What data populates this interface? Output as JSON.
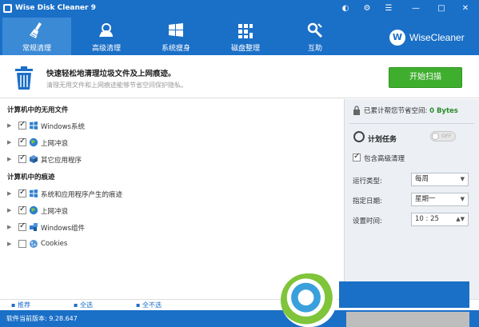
{
  "window": {
    "title": "Wise Disk Cleaner 9"
  },
  "tabs": [
    {
      "label": "常规清理",
      "icon": "broom-icon",
      "active": true
    },
    {
      "label": "高级清理",
      "icon": "advanced-clean-icon",
      "active": false
    },
    {
      "label": "系统瘦身",
      "icon": "windows-icon",
      "active": false
    },
    {
      "label": "磁盘整理",
      "icon": "defrag-icon",
      "active": false
    },
    {
      "label": "互助",
      "icon": "tools-icon",
      "active": false
    }
  ],
  "brand": {
    "logo_letter": "W",
    "name": "WiseCleaner"
  },
  "banner": {
    "title": "快速轻松地清理垃圾文件及上网痕迹。",
    "subtitle": "清理无用文件和上网痕迹能够节省空间保护隐私。",
    "scan_button": "开始扫描"
  },
  "left": {
    "section1_title": "计算机中的无用文件",
    "section1_items": [
      {
        "label": "Windows系统",
        "checked": true,
        "icon": "windows-icon"
      },
      {
        "label": "上网冲浪",
        "checked": true,
        "icon": "globe-icon"
      },
      {
        "label": "其它应用程序",
        "checked": true,
        "icon": "app-box-icon"
      }
    ],
    "section2_title": "计算机中的痕迹",
    "section2_items": [
      {
        "label": "系统和应用程序产生的痕迹",
        "checked": true,
        "icon": "windows-icon"
      },
      {
        "label": "上网冲浪",
        "checked": true,
        "icon": "globe-icon"
      },
      {
        "label": "Windows组件",
        "checked": true,
        "icon": "puzzle-icon"
      },
      {
        "label": "Cookies",
        "checked": false,
        "icon": "cookie-icon"
      }
    ]
  },
  "right": {
    "saved_label": "已累计帮您节省空间: ",
    "saved_value": "0 Bytes",
    "schedule_title": "计划任务",
    "toggle_text": "OFF",
    "include_advanced": "包含高级清理",
    "run_type_label": "运行类型:",
    "run_type_value": "每周",
    "date_label": "指定日期:",
    "date_value": "星期一",
    "time_label": "设置时间:",
    "time_value": "10 : 25"
  },
  "footer": {
    "recommend": "推荐",
    "select_all": "全选",
    "select_none": "全不选",
    "version": "软件当前版本: 9.28.647"
  },
  "colors": {
    "header_blue": "#1a6fc7",
    "active_tab": "#3b8ad6",
    "scan_green": "#3fae2e",
    "saved_green": "#2a8b2a"
  }
}
